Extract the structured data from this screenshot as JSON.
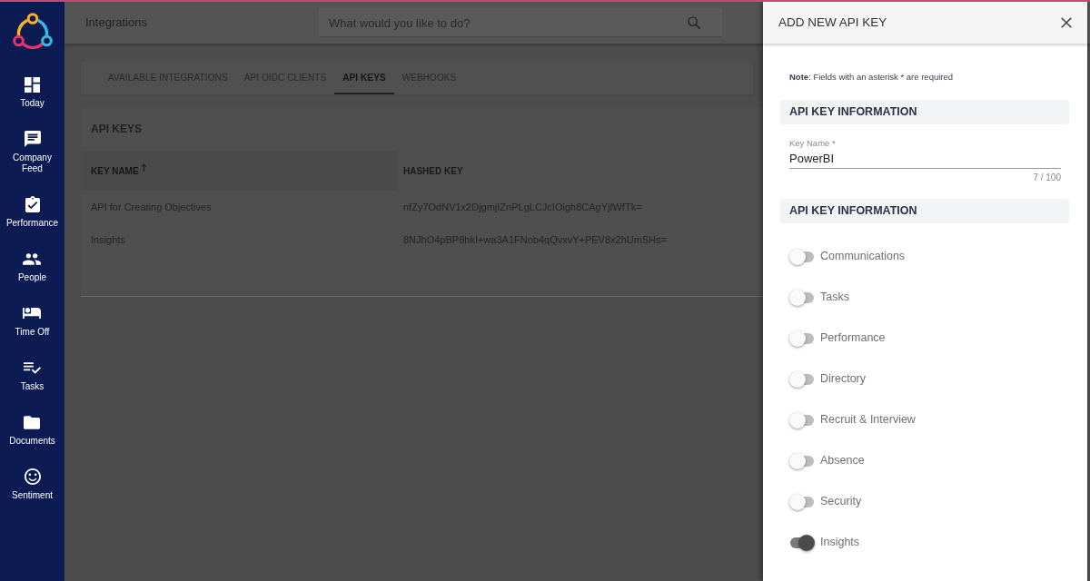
{
  "sidebar": {
    "items": [
      {
        "label": "Today"
      },
      {
        "label": "Company Feed"
      },
      {
        "label": "Performance"
      },
      {
        "label": "People"
      },
      {
        "label": "Time Off"
      },
      {
        "label": "Tasks"
      },
      {
        "label": "Documents"
      },
      {
        "label": "Sentiment"
      }
    ]
  },
  "topbar": {
    "title": "Integrations",
    "search": {
      "placeholder": "What would you like to do?"
    }
  },
  "tabs": [
    {
      "label": "AVAILABLE INTEGRATIONS",
      "selected": false
    },
    {
      "label": "API OIDC CLIENTS",
      "selected": false
    },
    {
      "label": "API KEYS",
      "selected": true
    },
    {
      "label": "WEBHOOKS",
      "selected": false
    }
  ],
  "api_keys": {
    "title": "API KEYS",
    "columns": [
      {
        "label": "KEY NAME",
        "sorted": true
      },
      {
        "label": "HASHED KEY",
        "sorted": false
      }
    ],
    "rows": [
      {
        "cells": [
          "API for Creating Objectives",
          "nfZy7OdNV1x2DjgmjIZnPLgLCJcIOigh8CAgYjfWfTk="
        ]
      },
      {
        "cells": [
          "Insights",
          "8NJhO4pBP8hkI+wa3A1FNob4qQvxvY+PEV8x2hUmSHs="
        ]
      }
    ]
  },
  "panel": {
    "title": "ADD NEW API KEY",
    "note": "**Note**: Fields with an asterisk * are required",
    "sections": [
      {
        "title": "API KEY INFORMATION",
        "fields": [
          {
            "label": "Key Name *",
            "value": "PowerBI",
            "counter": "7 / 100"
          }
        ]
      },
      {
        "title": "API KEY INFORMATION",
        "permissions": [
          {
            "label": "Communications",
            "on": false
          },
          {
            "label": "Tasks",
            "on": false
          },
          {
            "label": "Performance",
            "on": false
          },
          {
            "label": "Directory",
            "on": false
          },
          {
            "label": "Recruit & Interview",
            "on": false
          },
          {
            "label": "Absence",
            "on": false
          },
          {
            "label": "Security",
            "on": false
          },
          {
            "label": "Insights",
            "on": true
          }
        ]
      }
    ]
  }
}
